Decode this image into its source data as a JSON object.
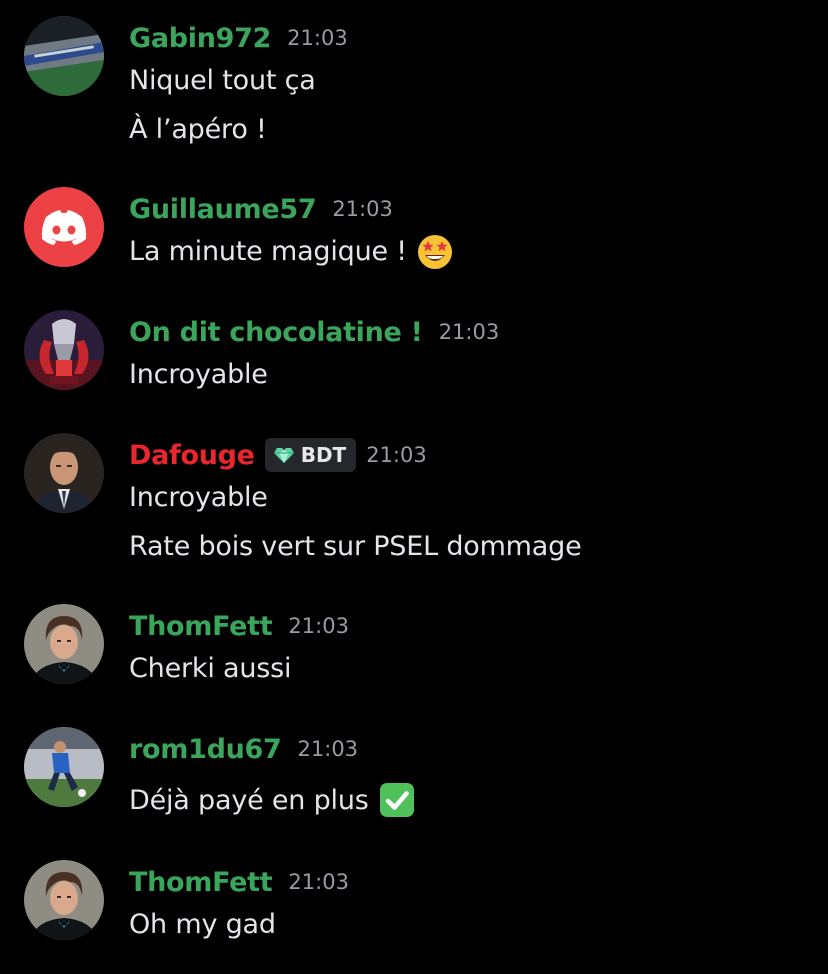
{
  "messages": [
    {
      "username": "Gabin972",
      "username_color": "#3ba55c",
      "time": "21:03",
      "avatar_icon": "stadium-photo-avatar",
      "lines": [
        "Niquel tout ça",
        "À l’apéro !"
      ]
    },
    {
      "username": "Guillaume57",
      "username_color": "#3ba55c",
      "time": "21:03",
      "avatar_icon": "discord-logo-avatar",
      "lines": [
        "La minute magique !"
      ],
      "emoji": "star-struck-emoji"
    },
    {
      "username": "On dit chocolatine !",
      "username_color": "#3ba55c",
      "time": "21:03",
      "avatar_icon": "trophy-avatar",
      "lines": [
        "Incroyable"
      ]
    },
    {
      "username": "Dafouge",
      "username_color": "#e8262b",
      "time": "21:03",
      "avatar_icon": "man-in-suit-avatar",
      "badge": {
        "icon": "heart-gem-icon",
        "label": "BDT"
      },
      "lines": [
        "Incroyable",
        "Rate bois vert sur PSEL dommage"
      ]
    },
    {
      "username": "ThomFett",
      "username_color": "#3ba55c",
      "time": "21:03",
      "avatar_icon": "portrait-avatar",
      "lines": [
        "Cherki aussi"
      ]
    },
    {
      "username": "rom1du67",
      "username_color": "#3ba55c",
      "time": "21:03",
      "avatar_icon": "footballer-avatar",
      "lines": [
        "Déjà payé en plus"
      ],
      "emoji": "check-mark-emoji"
    },
    {
      "username": "ThomFett",
      "username_color": "#3ba55c",
      "time": "21:03",
      "avatar_icon": "portrait-avatar",
      "lines": [
        "Oh my gad"
      ]
    }
  ]
}
